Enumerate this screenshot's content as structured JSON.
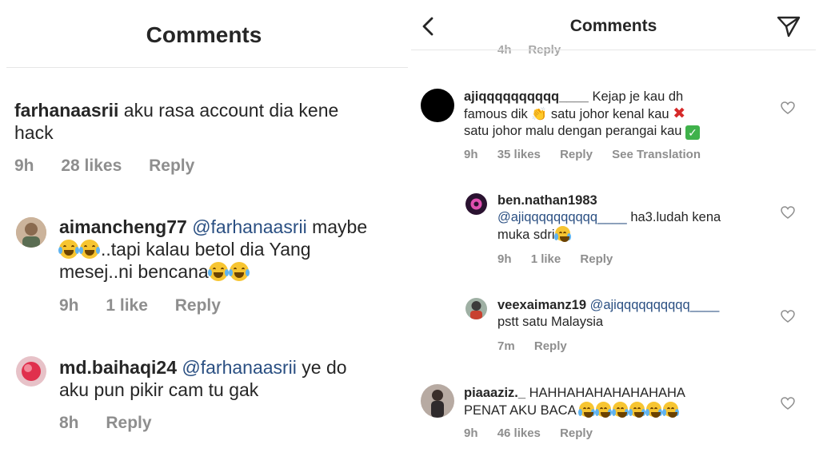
{
  "left": {
    "title": "Comments",
    "comments": [
      {
        "username": "farhanaasrii",
        "text_line1": "aku rasa account dia kene",
        "text_line2": "hack",
        "time": "9h",
        "likes": "28 likes",
        "reply": "Reply"
      },
      {
        "username": "aimancheng77",
        "mention": "@farhanaasrii",
        "text_a": "maybe",
        "text_b": "..tapi kalau betol dia Yang",
        "text_c": "mesej..ni bencana",
        "time": "9h",
        "likes": "1 like",
        "reply": "Reply"
      },
      {
        "username": "md.baihaqi24",
        "mention": "@farhanaasrii",
        "text_a": "ye do",
        "text_b": "aku pun pikir cam tu gak",
        "time": "8h",
        "reply": "Reply"
      }
    ]
  },
  "right": {
    "title": "Comments",
    "cut_meta": "4h     Reply",
    "comments": [
      {
        "username": "ajiqqqqqqqqqq____",
        "text_a": "Kejap je kau dh",
        "text_b": "famous dik",
        "text_c": "satu johor kenal kau",
        "text_d": "satu johor malu dengan perangai kau",
        "time": "9h",
        "likes": "35 likes",
        "reply": "Reply",
        "translate": "See Translation"
      },
      {
        "username": "ben.nathan1983",
        "mention": "@ajiqqqqqqqqqq____",
        "text_a": "ha3.ludah kena",
        "text_b": "muka sdri",
        "time": "9h",
        "likes": "1 like",
        "reply": "Reply"
      },
      {
        "username": "veexaimanz19",
        "mention": "@ajiqqqqqqqqqq____",
        "text_a": "pstt satu Malaysia",
        "time": "7m",
        "reply": "Reply"
      },
      {
        "username": "piaaaziz._",
        "text_a": "HAHHAHAHAHAHAHAHA",
        "text_b": "PENAT AKU BACA",
        "time": "9h",
        "likes": "46 likes",
        "reply": "Reply"
      }
    ]
  },
  "icons": [
    "back-arrow-icon",
    "send-icon",
    "heart-icon",
    "laugh-cry-emoji-icon",
    "clap-emoji-icon",
    "cross-emoji-icon",
    "check-emoji-icon"
  ]
}
